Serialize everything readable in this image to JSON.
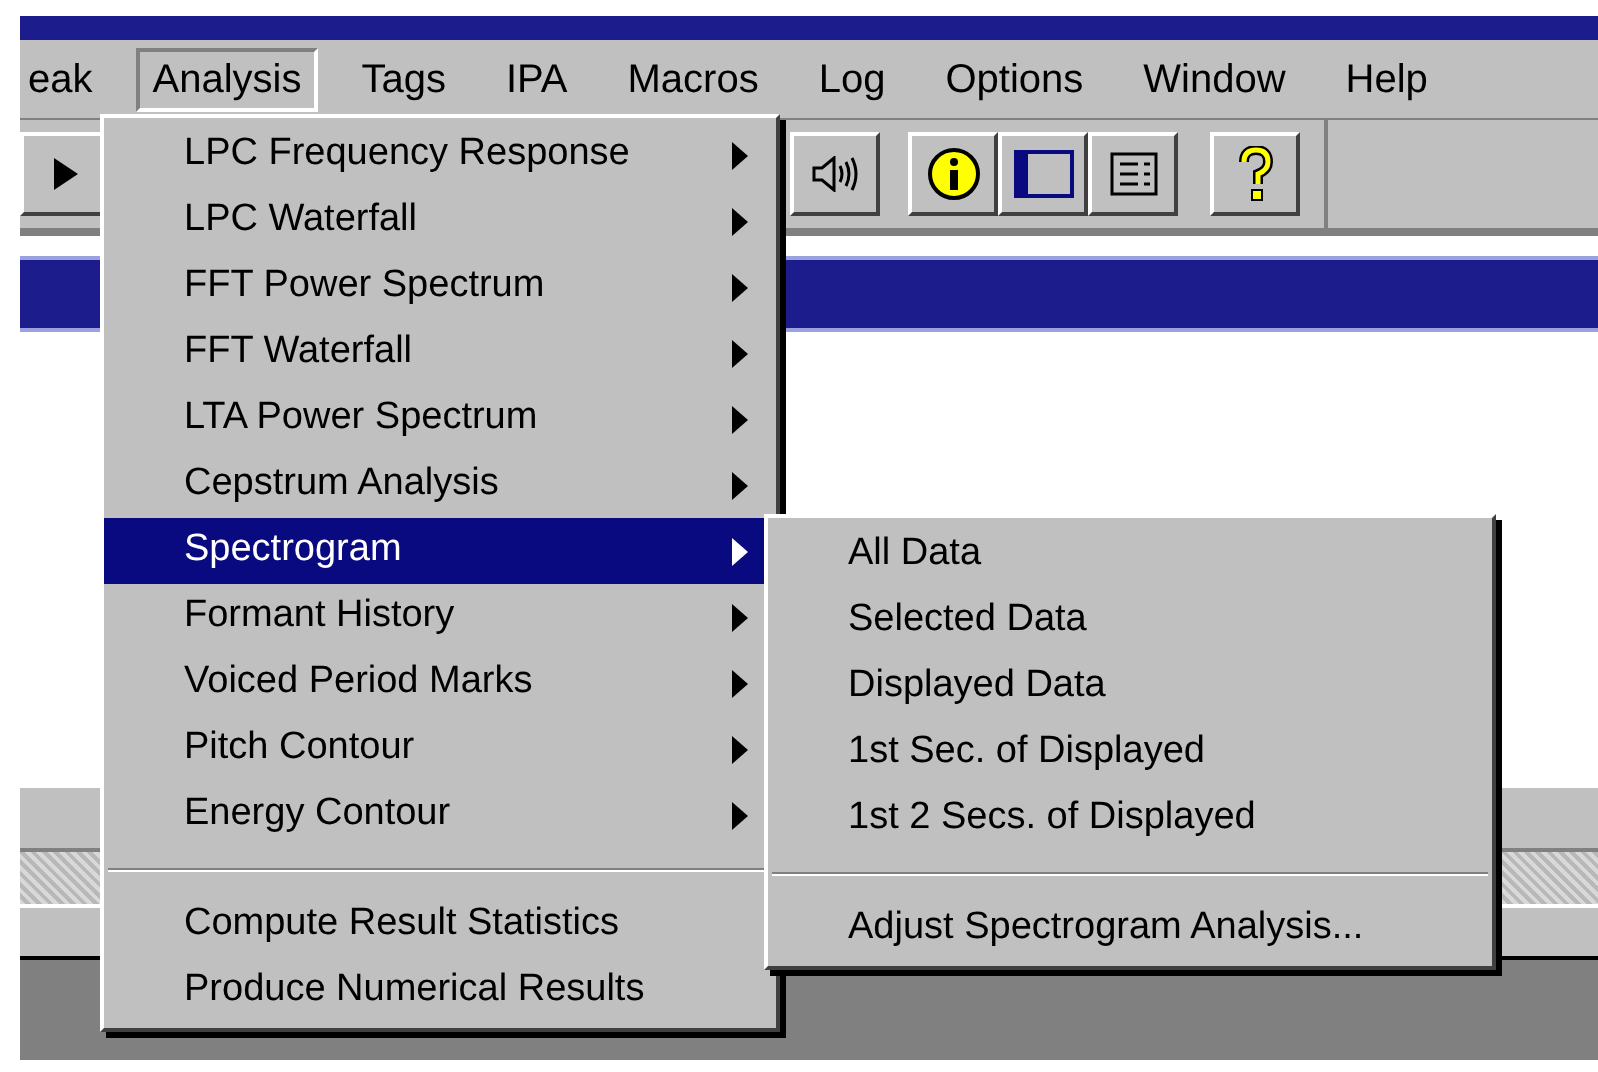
{
  "menubar": [
    {
      "label": "eak",
      "selected": false
    },
    {
      "label": "Analysis",
      "selected": true
    },
    {
      "label": "Tags",
      "selected": false
    },
    {
      "label": "IPA",
      "selected": false
    },
    {
      "label": "Macros",
      "selected": false
    },
    {
      "label": "Log",
      "selected": false
    },
    {
      "label": "Options",
      "selected": false
    },
    {
      "label": "Window",
      "selected": false
    },
    {
      "label": "Help",
      "selected": false
    }
  ],
  "analysis_menu": [
    {
      "kind": "submenu",
      "label": "LPC Frequency Response",
      "selected": false
    },
    {
      "kind": "submenu",
      "label": "LPC Waterfall",
      "selected": false
    },
    {
      "kind": "submenu",
      "label": "FFT Power Spectrum",
      "selected": false
    },
    {
      "kind": "submenu",
      "label": "FFT Waterfall",
      "selected": false
    },
    {
      "kind": "submenu",
      "label": "LTA Power Spectrum",
      "selected": false
    },
    {
      "kind": "submenu",
      "label": "Cepstrum Analysis",
      "selected": false
    },
    {
      "kind": "submenu",
      "label": "Spectrogram",
      "selected": true
    },
    {
      "kind": "submenu",
      "label": "Formant History",
      "selected": false
    },
    {
      "kind": "submenu",
      "label": "Voiced Period Marks",
      "selected": false
    },
    {
      "kind": "submenu",
      "label": "Pitch Contour",
      "selected": false
    },
    {
      "kind": "submenu",
      "label": "Energy Contour",
      "selected": false
    },
    {
      "kind": "separator"
    },
    {
      "kind": "command",
      "label": "Compute Result Statistics",
      "selected": false
    },
    {
      "kind": "command",
      "label": "Produce Numerical Results",
      "selected": false
    }
  ],
  "spectrogram_submenu": [
    {
      "kind": "command",
      "label": "All Data",
      "selected": false
    },
    {
      "kind": "command",
      "label": "Selected Data",
      "selected": false
    },
    {
      "kind": "command",
      "label": "Displayed Data",
      "selected": false
    },
    {
      "kind": "command",
      "label": "1st Sec. of Displayed",
      "selected": false
    },
    {
      "kind": "command",
      "label": "1st 2 Secs. of Displayed",
      "selected": false
    },
    {
      "kind": "separator"
    },
    {
      "kind": "command",
      "label": "Adjust Spectrogram Analysis...",
      "selected": false
    }
  ]
}
